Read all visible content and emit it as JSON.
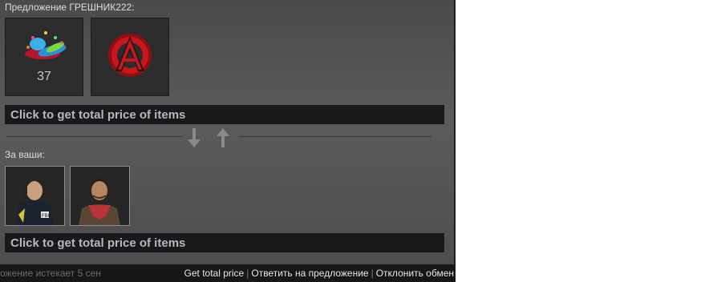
{
  "offer": {
    "partner_label": "Предложение ГРЕШНИК222:",
    "your_label": "За ваши:",
    "their_items": [
      {
        "icon": "holiday-gift-icon",
        "quantity": "37"
      },
      {
        "icon": "red-emblem-icon",
        "quantity": ""
      }
    ],
    "your_items": [
      {
        "icon": "fbi-agent-icon"
      },
      {
        "icon": "bandana-agent-icon"
      }
    ],
    "price_bar_top": "Click to get total price of items",
    "price_bar_bottom": "Click to get total price of items"
  },
  "footer": {
    "expiry_text": "ожение истекает 5 сен",
    "get_total_price": "Get total price",
    "respond": "Ответить на предложение",
    "decline": "Отклонить обмен"
  },
  "colors": {
    "panel_bg": "#505050",
    "price_bar_bg": "#17191b",
    "footer_bg": "#171717",
    "emblem_red": "#c8161c"
  }
}
